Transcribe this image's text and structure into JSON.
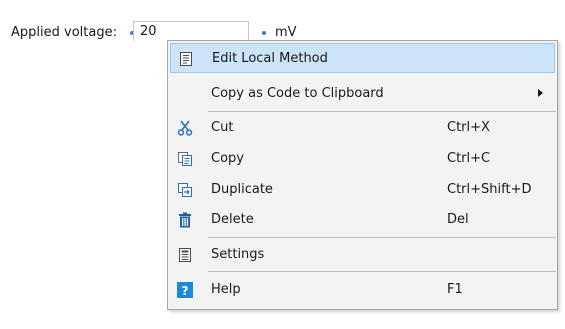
{
  "form": {
    "label": "Applied voltage:",
    "value": "20",
    "unit": "mV"
  },
  "context_menu": {
    "items": [
      {
        "label": "Edit Local Method",
        "shortcut": "",
        "icon": "edit-document-icon",
        "highlighted": true
      },
      {
        "label": "Copy as Code to Clipboard",
        "shortcut": "",
        "icon": "",
        "submenu": true
      },
      {
        "label": "Cut",
        "shortcut": "Ctrl+X",
        "icon": "scissors-icon"
      },
      {
        "label": "Copy",
        "shortcut": "Ctrl+C",
        "icon": "copy-icon"
      },
      {
        "label": "Duplicate",
        "shortcut": "Ctrl+Shift+D",
        "icon": "duplicate-icon"
      },
      {
        "label": "Delete",
        "shortcut": "Del",
        "icon": "trash-icon"
      },
      {
        "label": "Settings",
        "shortcut": "",
        "icon": "settings-document-icon"
      },
      {
        "label": "Help",
        "shortcut": "F1",
        "icon": "help-icon"
      }
    ]
  },
  "colors": {
    "highlight": "#cce4f7",
    "accent": "#3e7bd6",
    "help_icon": "#1e88d8",
    "trash_icon": "#1f5fa8"
  }
}
